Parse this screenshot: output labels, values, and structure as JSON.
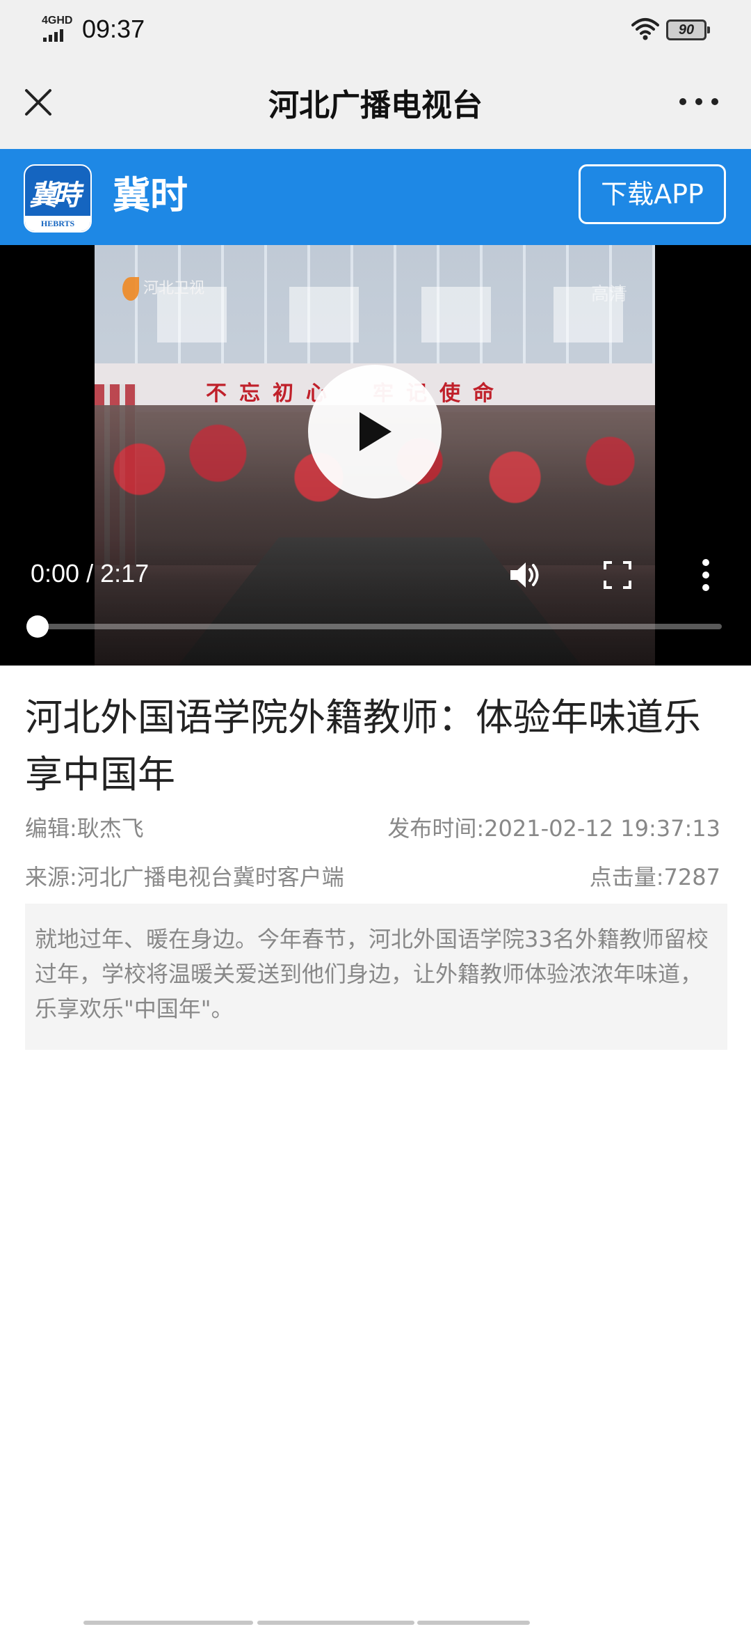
{
  "status_bar": {
    "network": "4GHD",
    "time": "09:37",
    "battery": "90",
    "icons": [
      "signal-icon",
      "wifi-icon",
      "battery-icon"
    ]
  },
  "title_bar": {
    "title": "河北广播电视台",
    "close_icon": "close-icon",
    "more_icon": "more-icon"
  },
  "app_banner": {
    "name": "冀时",
    "logo_text": "冀時",
    "logo_ribbon": "HEBRTS",
    "download_label": "下载APP",
    "background_color": "#1e88e5"
  },
  "video": {
    "current_time": "0:00",
    "separator": " / ",
    "duration": "2:17",
    "progress": 0,
    "channel_logo": "河北卫视",
    "hd_mark": "高清",
    "slogan": "不忘初心　牢记使命",
    "icons": [
      "play-icon",
      "volume-icon",
      "fullscreen-icon",
      "overflow-icon"
    ]
  },
  "article": {
    "title": "河北外国语学院外籍教师：体验年味道乐享中国年",
    "editor": "编辑:耿杰飞",
    "publish_time": "发布时间:2021-02-12 19:37:13",
    "source": "来源:河北广播电视台冀时客户端",
    "clicks": "点击量:7287",
    "summary": "就地过年、暖在身边。今年春节，河北外国语学院33名外籍教师留校过年，学校将温暖关爱送到他们身边，让外籍教师体验浓浓年味道，乐享欢乐\"中国年\"。"
  }
}
